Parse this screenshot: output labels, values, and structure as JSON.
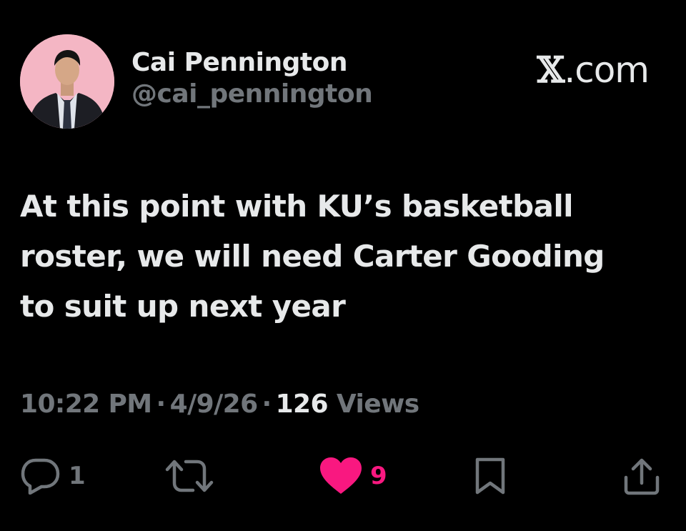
{
  "author": {
    "display_name": "Cai Pennington",
    "handle": "@cai_pennington",
    "avatar_icon": "profile-photo"
  },
  "brand": {
    "x_mark": "𝕏",
    "domain": ".com"
  },
  "tweet": {
    "lines": [
      "At this point with KU’s basketball",
      "roster, we will need Carter Gooding",
      "to suit up next year"
    ]
  },
  "meta": {
    "time": "10:22 PM",
    "separator": "·",
    "date": "4/9/26",
    "views_count": "126",
    "views_label": "Views"
  },
  "actions": {
    "reply": {
      "icon": "reply-icon",
      "count": "1"
    },
    "repost": {
      "icon": "repost-icon",
      "count": ""
    },
    "like": {
      "icon": "heart-icon",
      "count": "9",
      "liked": true
    },
    "bookmark": {
      "icon": "bookmark-icon"
    },
    "share": {
      "icon": "share-icon"
    }
  },
  "colors": {
    "background": "#000000",
    "primary_text": "#e7e9ea",
    "secondary_text": "#71767b",
    "like_accent": "#f91880",
    "avatar_bg": "#f4b6c4"
  }
}
